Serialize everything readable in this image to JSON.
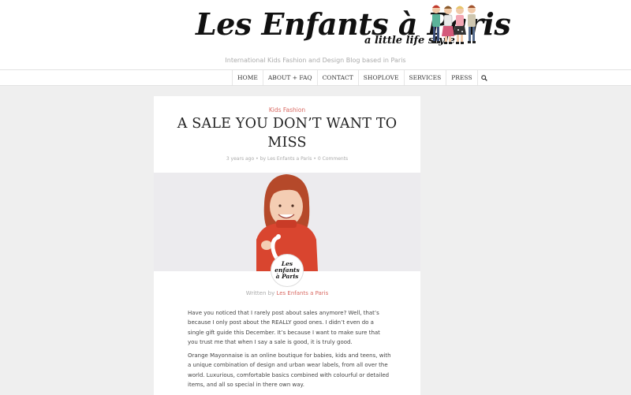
{
  "header": {
    "logo_title": "Les Enfants à Paris",
    "logo_subtitle": "a little life style",
    "tagline": "International Kids Fashion and Design Blog based in Paris"
  },
  "nav": {
    "items": [
      "HOME",
      "ABOUT + FAQ",
      "CONTACT",
      "SHOPLOVE",
      "SERVICES",
      "PRESS"
    ],
    "search_icon": "search-icon"
  },
  "post": {
    "category": "Kids Fashion",
    "title": "A SALE YOU DON’T WANT TO MISS",
    "meta": {
      "time": "3 years ago",
      "by_prefix": "by",
      "author": "Les Enfants a Paris",
      "comments": "0 Comments"
    },
    "badge_lines": [
      "Les",
      "enfants",
      "à Paris"
    ],
    "written_prefix": "Written by",
    "written_author": "Les Enfants a Paris",
    "paragraphs": [
      "Have you noticed that I rarely post about sales anymore? Well, that’s because I only post about the REALLY good ones. I didn’t even do a single gift guide this December. It’s because I want to make sure that you trust me that when I say a sale is good, it is truly good.",
      "Orange Mayonnaise is an online boutique for babies, kids and teens, with a unique combination of design and urban wear labels, from all over the world. Luxurious, comfortable basics combined with colourful or detailed items, and all so special in there own way."
    ]
  },
  "colors": {
    "accent": "#d96a63",
    "background": "#efefef",
    "card": "#ffffff"
  }
}
